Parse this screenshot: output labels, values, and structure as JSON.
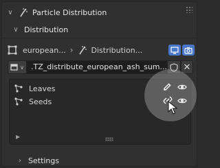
{
  "header": {
    "title": "Particle Distribution"
  },
  "subpanel": {
    "title": "Distribution"
  },
  "context": {
    "object_name": "european...",
    "particle_name": "Distribution..."
  },
  "slot": {
    "name": ".TZ_distribute_european_ash_sum..."
  },
  "list": {
    "items": [
      {
        "label": "Leaves"
      },
      {
        "label": "Seeds"
      }
    ]
  },
  "settings": {
    "title": "Settings"
  },
  "colors": {
    "accent": "#4a77c7",
    "panel": "#303030",
    "field": "#1e1e1e"
  }
}
